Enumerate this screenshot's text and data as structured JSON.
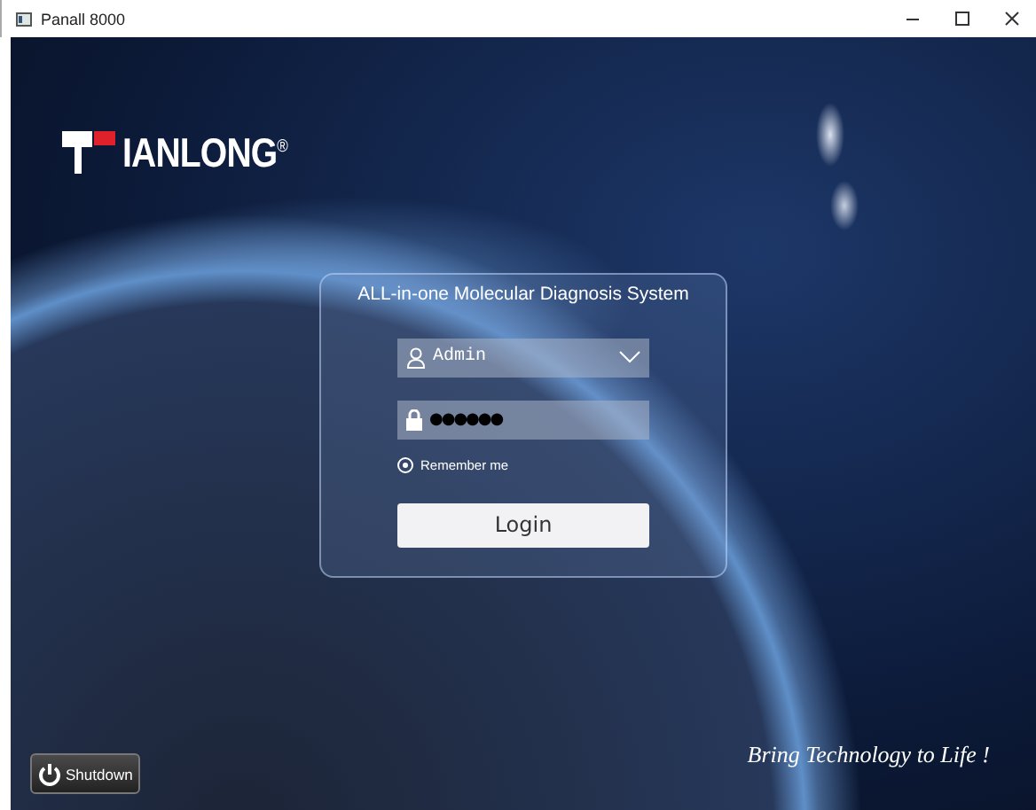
{
  "window": {
    "title": "Panall 8000"
  },
  "logo": {
    "text": "IANLONG$^{®}$"
  },
  "login": {
    "title": "ALL-in-one Molecular Diagnosis System",
    "user": {
      "value": "Admin"
    },
    "password": {
      "value": "●●●●●●"
    },
    "remember": {
      "label": "Remember me",
      "selected": true
    },
    "button": "Login"
  },
  "shutdown": {
    "label": "Shutdown"
  },
  "slogan": "Bring Technology to Life !"
}
